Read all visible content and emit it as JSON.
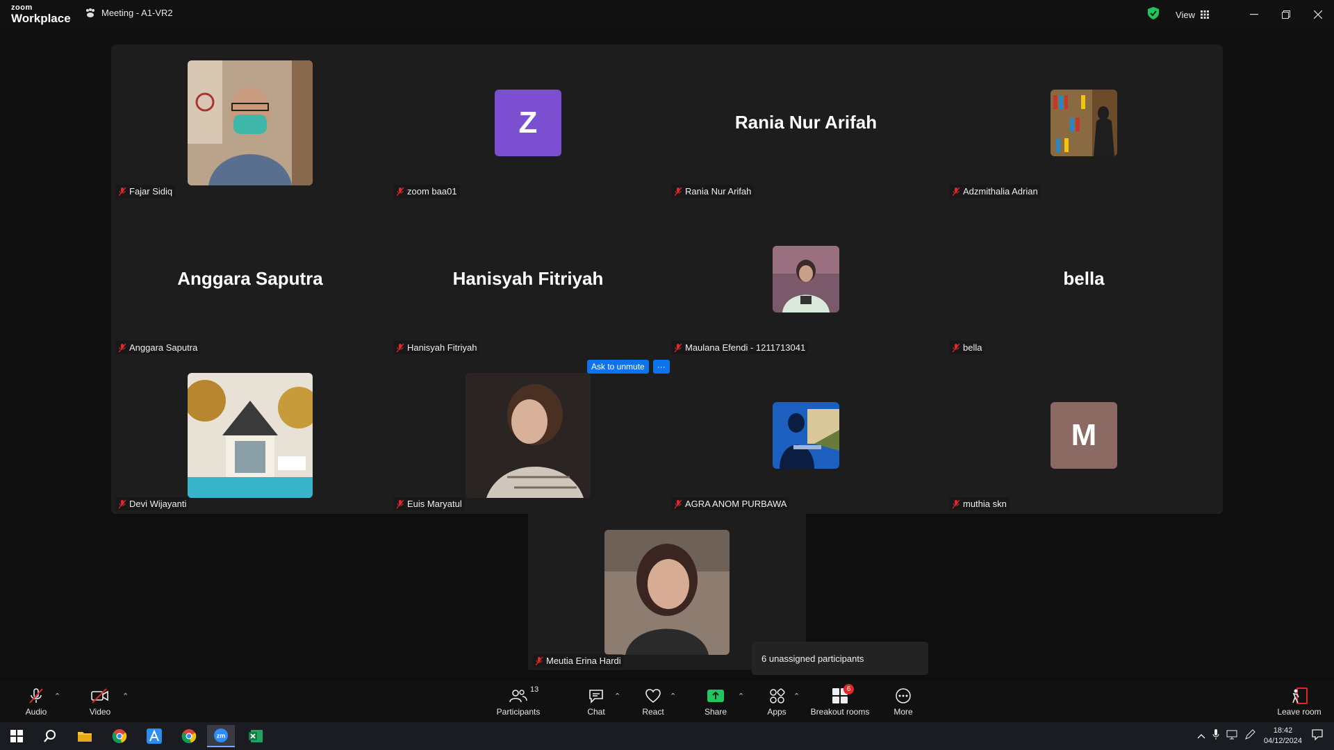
{
  "titlebar": {
    "brand_top": "zoom",
    "brand_bottom": "Workplace",
    "meeting_title": "Meeting - A1-VR2",
    "view_label": "View"
  },
  "participants": [
    {
      "name": "Fajar Sidiq",
      "display": "photo",
      "icon": "man-with-mask-photo"
    },
    {
      "name": "zoom baa01",
      "display": "letter",
      "letter": "Z",
      "color": "#7b4fcf"
    },
    {
      "name": "Rania Nur Arifah",
      "display": "name",
      "big_name": "Rania Nur Arifah"
    },
    {
      "name": "Adzmithalia Adrian",
      "display": "photo",
      "icon": "bookshelf-photo"
    },
    {
      "name": "Anggara Saputra",
      "display": "name",
      "big_name": "Anggara Saputra"
    },
    {
      "name": "Hanisyah Fitriyah",
      "display": "name",
      "big_name": "Hanisyah Fitriyah"
    },
    {
      "name": "Maulana Efendi - 1211713041",
      "display": "photo",
      "icon": "person-photo"
    },
    {
      "name": "bella",
      "display": "name",
      "big_name": "bella"
    },
    {
      "name": "Devi Wijayanti",
      "display": "photo",
      "icon": "house-photo"
    },
    {
      "name": "Euis Maryatul",
      "display": "photo",
      "icon": "woman-laughing-photo"
    },
    {
      "name": "AGRA ANOM PURBAWA",
      "display": "photo",
      "icon": "laptop-silhouette-photo"
    },
    {
      "name": "muthia skn",
      "display": "letter",
      "letter": "M",
      "color": "#8a6a62"
    },
    {
      "name": "Meutia Erina Hardi",
      "display": "photo",
      "icon": "woman-portrait-photo"
    }
  ],
  "ask_to_unmute": {
    "label": "Ask to unmute",
    "more": "···"
  },
  "toast": {
    "text": "6 unassigned participants"
  },
  "toolbar": {
    "audio": "Audio",
    "video": "Video",
    "participants": "Participants",
    "participants_count": "13",
    "chat": "Chat",
    "react": "React",
    "share": "Share",
    "apps": "Apps",
    "breakout": "Breakout rooms",
    "breakout_badge": "6",
    "more": "More",
    "leave": "Leave room"
  },
  "taskbar": {
    "time": "18:42",
    "date": "04/12/2024"
  },
  "colors": {
    "accent_blue": "#0e72ed",
    "share_green": "#22c55e",
    "muted_red": "#e02828",
    "tile_bg": "#1d1d1d"
  }
}
